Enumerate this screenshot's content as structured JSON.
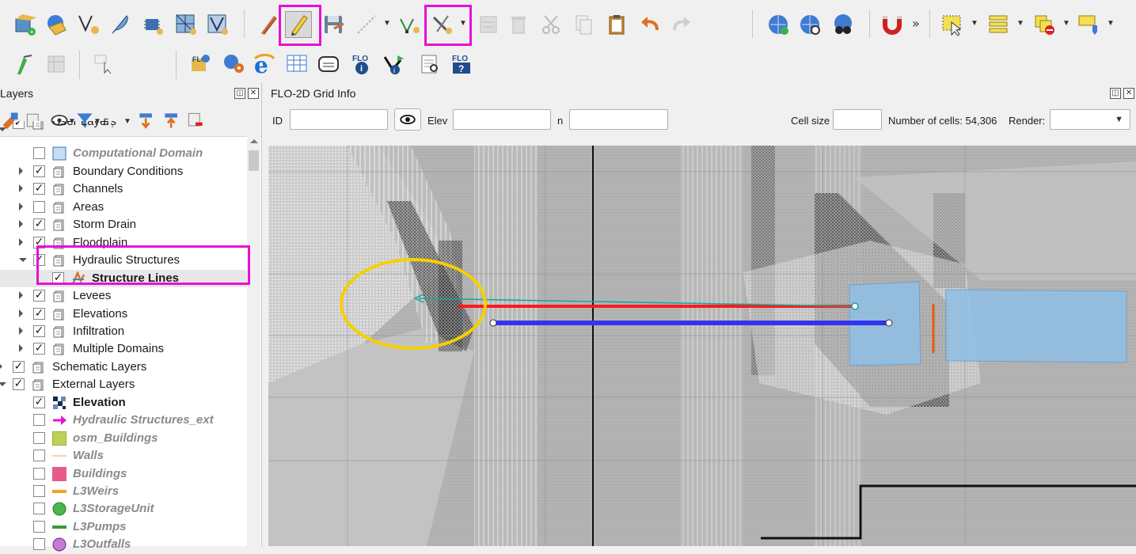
{
  "toolbar_top": {
    "buttons": [
      {
        "name": "add-layer-icon"
      },
      {
        "name": "open-project-icon"
      },
      {
        "name": "vertex-tool-icon"
      },
      {
        "name": "feather-icon"
      },
      {
        "name": "chip-icon"
      },
      {
        "name": "grid-table-icon"
      },
      {
        "name": "vector-shield-icon"
      },
      {
        "name": "pencil-brush-icon"
      },
      {
        "name": "toggle-editing-icon"
      },
      {
        "name": "save-edits-icon"
      },
      {
        "name": "digitize-line-icon"
      },
      {
        "name": "vertex-editor-icon"
      },
      {
        "name": "advanced-digitize-icon"
      },
      {
        "name": "modify-attributes-icon"
      },
      {
        "name": "delete-feature-icon"
      },
      {
        "name": "cut-icon"
      },
      {
        "name": "copy-icon"
      },
      {
        "name": "paste-icon"
      },
      {
        "name": "undo-icon"
      },
      {
        "name": "redo-icon"
      },
      {
        "name": "globe-add-icon"
      },
      {
        "name": "globe-search-icon"
      },
      {
        "name": "globe-binoculars-icon"
      },
      {
        "name": "magnet-icon"
      },
      {
        "name": "select-feature-icon"
      },
      {
        "name": "attribute-table-icon"
      },
      {
        "name": "deselect-icon"
      },
      {
        "name": "label-icon"
      }
    ],
    "overflow": "»"
  },
  "layers_panel": {
    "title": "Layers",
    "items": [
      {
        "label": "User Layers",
        "indent": 1,
        "expand": "down",
        "checked": true,
        "icon": "group",
        "style": "normal",
        "partial": true
      },
      {
        "label": "Computational Domain",
        "indent": 2,
        "expand": "",
        "checked": false,
        "icon": "polygon-lightblue",
        "style": "ital"
      },
      {
        "label": "Boundary Conditions",
        "indent": 2,
        "expand": "right",
        "checked": true,
        "icon": "group",
        "style": "normal"
      },
      {
        "label": "Channels",
        "indent": 2,
        "expand": "right",
        "checked": true,
        "icon": "group",
        "style": "normal"
      },
      {
        "label": "Areas",
        "indent": 2,
        "expand": "right",
        "checked": false,
        "icon": "group",
        "style": "normal"
      },
      {
        "label": "Storm Drain",
        "indent": 2,
        "expand": "right",
        "checked": true,
        "icon": "group",
        "style": "normal"
      },
      {
        "label": "Floodplain",
        "indent": 2,
        "expand": "right",
        "checked": true,
        "icon": "group",
        "style": "normal"
      },
      {
        "label": "Hydraulic Structures",
        "indent": 2,
        "expand": "down",
        "checked": true,
        "icon": "group",
        "style": "normal"
      },
      {
        "label": "Structure Lines",
        "indent": 3,
        "expand": "",
        "checked": true,
        "icon": "structure-lines",
        "style": "ul",
        "selected": true
      },
      {
        "label": "Levees",
        "indent": 2,
        "expand": "right",
        "checked": true,
        "icon": "group",
        "style": "normal"
      },
      {
        "label": "Elevations",
        "indent": 2,
        "expand": "right",
        "checked": true,
        "icon": "group",
        "style": "normal"
      },
      {
        "label": "Infiltration",
        "indent": 2,
        "expand": "right",
        "checked": true,
        "icon": "group",
        "style": "normal"
      },
      {
        "label": "Multiple Domains",
        "indent": 2,
        "expand": "right",
        "checked": true,
        "icon": "group",
        "style": "normal"
      },
      {
        "label": "Schematic Layers",
        "indent": 1,
        "expand": "right",
        "checked": true,
        "icon": "group",
        "style": "normal"
      },
      {
        "label": "External Layers",
        "indent": 1,
        "expand": "down",
        "checked": true,
        "icon": "group",
        "style": "normal"
      },
      {
        "label": "Elevation",
        "indent": 2,
        "expand": "",
        "checked": true,
        "icon": "raster",
        "style": "bold"
      },
      {
        "label": "Hydraulic Structures_ext",
        "indent": 2,
        "expand": "",
        "checked": false,
        "icon": "arrow-magenta",
        "style": "ital"
      },
      {
        "label": "osm_Buildings",
        "indent": 2,
        "expand": "",
        "checked": false,
        "icon": "square-green",
        "style": "ital"
      },
      {
        "label": "Walls",
        "indent": 2,
        "expand": "",
        "checked": false,
        "icon": "line-tan",
        "style": "ital"
      },
      {
        "label": "Buildings",
        "indent": 2,
        "expand": "",
        "checked": false,
        "icon": "square-pink",
        "style": "ital"
      },
      {
        "label": "L3Weirs",
        "indent": 2,
        "expand": "",
        "checked": false,
        "icon": "line-orange",
        "style": "ital"
      },
      {
        "label": "L3StorageUnit",
        "indent": 2,
        "expand": "",
        "checked": false,
        "icon": "circle-green",
        "style": "ital"
      },
      {
        "label": "L3Pumps",
        "indent": 2,
        "expand": "",
        "checked": false,
        "icon": "line-green",
        "style": "ital"
      },
      {
        "label": "L3Outfalls",
        "indent": 2,
        "expand": "",
        "checked": false,
        "icon": "circle-purple",
        "style": "ital"
      }
    ]
  },
  "grid_info": {
    "title": "FLO-2D Grid Info",
    "id_label": "ID",
    "id_value": "",
    "elev_label": "Elev",
    "elev_value": "",
    "n_label": "n",
    "n_value": "",
    "cell_size_label": "Cell size",
    "cell_size_value": "",
    "cells_text": "Number of cells: 54,306",
    "render_label": "Render:",
    "render_value": ""
  },
  "colors": {
    "highlight": "#e80fd6",
    "ellipse": "#f5d000",
    "red_line": "#ff1a1a",
    "blue_line": "#3333ee",
    "teal_arrow": "#1aa69a",
    "structure_fill": "#8fbfe6"
  }
}
